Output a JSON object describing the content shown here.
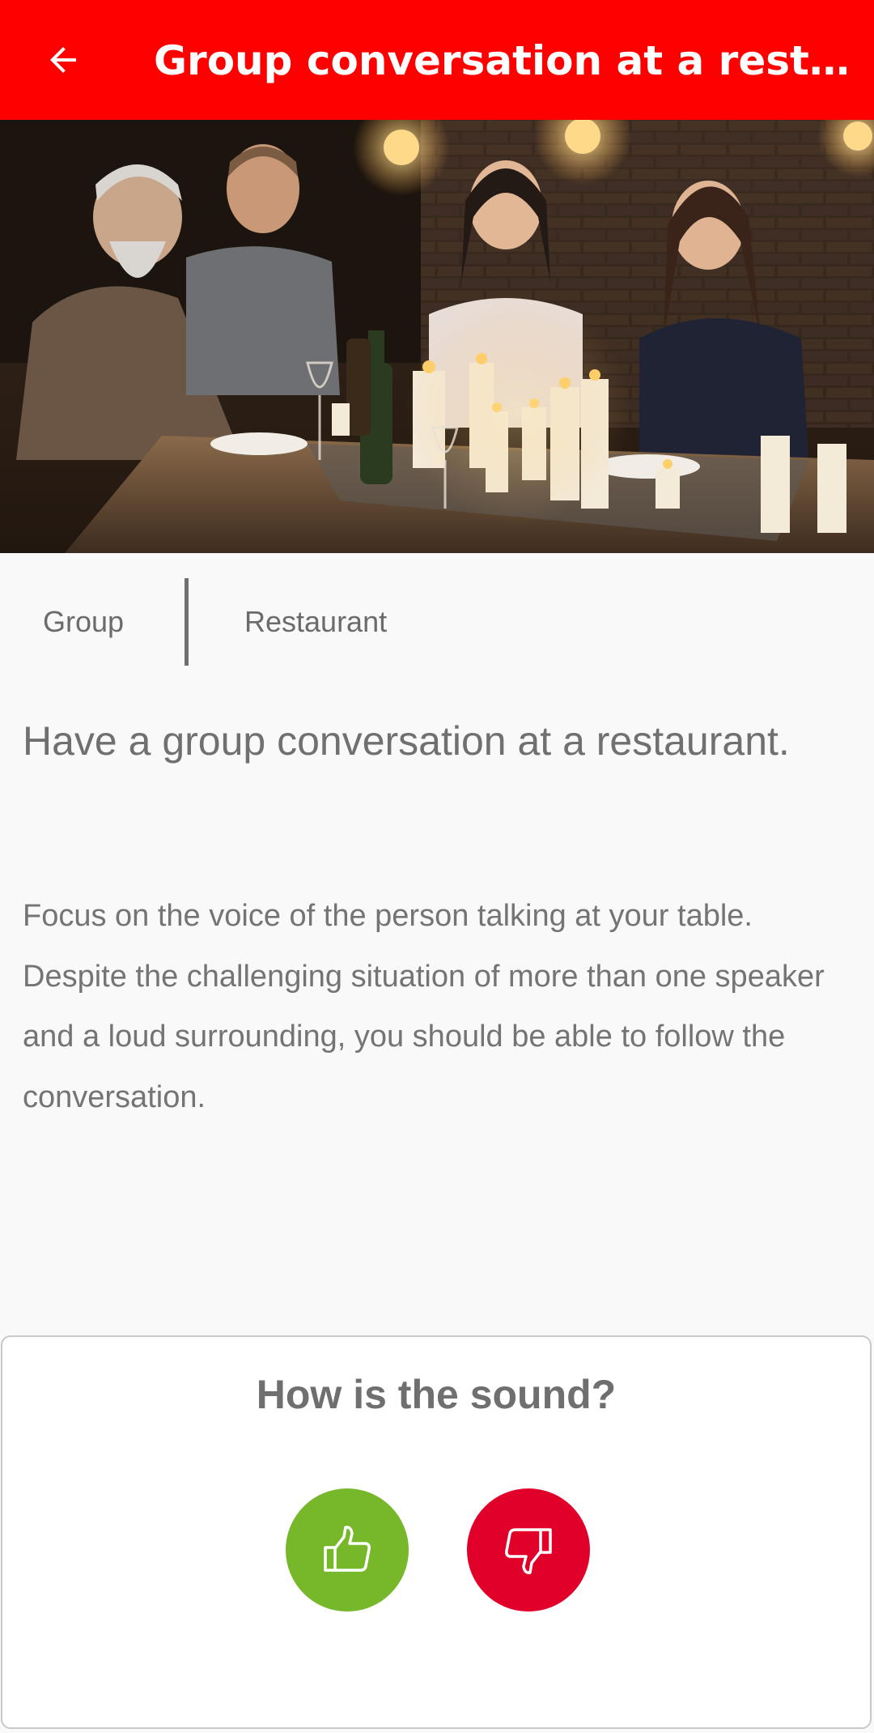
{
  "appbar": {
    "title": "Group conversation at a restaurant",
    "back_icon": "arrow-left-icon",
    "background": "#fe0000"
  },
  "hero": {
    "image_alt": "People laughing and talking around a candlelit restaurant table"
  },
  "tags": [
    {
      "label": "Group"
    },
    {
      "label": "Restaurant"
    }
  ],
  "content": {
    "heading": "Have a group conversation at a restaurant.",
    "description": "Focus on the voice of the person talking at your table. Despite the challenging situation of more than one speaker and a loud surrounding, you should be able to follow the conversation."
  },
  "feedback": {
    "title": "How is the sound?",
    "positive_icon": "thumbs-up-icon",
    "negative_icon": "thumbs-down-icon",
    "positive_color": "#76b82a",
    "negative_color": "#e0002a"
  }
}
